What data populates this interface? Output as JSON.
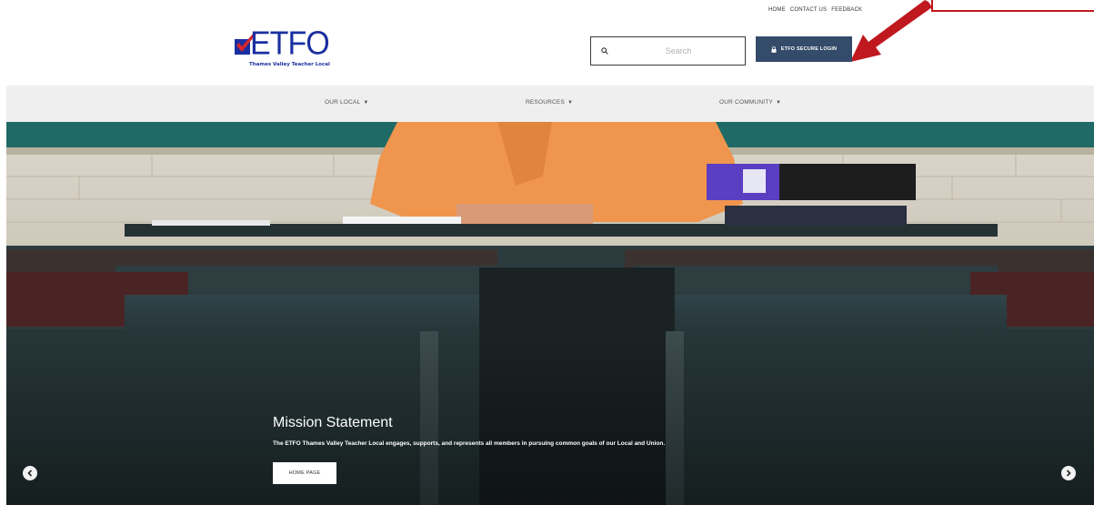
{
  "top_links": [
    "HOME",
    "CONTACT US",
    "FEEDBACK"
  ],
  "logo": {
    "text": "ETFO",
    "subtitle": "Thames Valley Teacher Local"
  },
  "search": {
    "placeholder": "Search",
    "icon": "search-icon"
  },
  "login": {
    "label": "ETFO SECURE LOGIN",
    "icon": "lock-icon"
  },
  "nav": [
    {
      "label": "OUR LOCAL",
      "caret": "▼"
    },
    {
      "label": "RESOURCES",
      "caret": "▼"
    },
    {
      "label": "OUR COMMUNITY",
      "caret": "▼"
    }
  ],
  "hero": {
    "title": "Mission Statement",
    "text": "The ETFO Thames Valley Teacher Local engages, supports, and represents all members in pursuing common goals of our Local and Union.",
    "button": "HOME PAGE",
    "prev_icon": "chevron-left-icon",
    "next_icon": "chevron-right-icon"
  },
  "colors": {
    "brand_blue": "#1a2fa0",
    "logo_check": "#d6262d",
    "login_bg": "#344b69",
    "nav_bg": "#efefef",
    "annotation_red": "#c0181f"
  }
}
